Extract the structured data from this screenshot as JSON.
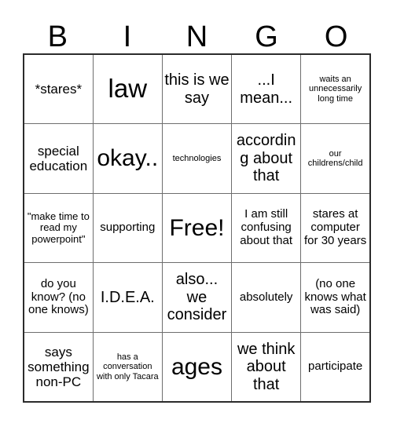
{
  "card": {
    "headers": [
      "B",
      "I",
      "N",
      "G",
      "O"
    ],
    "rows": [
      [
        {
          "text": "*stares*",
          "size": "fs-l"
        },
        {
          "text": "law",
          "size": "fs-huge"
        },
        {
          "text": "this is we say",
          "size": "fs-xl"
        },
        {
          "text": "...I mean...",
          "size": "fs-xl"
        },
        {
          "text": "waits an unnecessarily long time",
          "size": "fs-xs"
        }
      ],
      [
        {
          "text": "special education",
          "size": "fs-l"
        },
        {
          "text": "okay..",
          "size": "fs-xxl"
        },
        {
          "text": "technologies",
          "size": "fs-xs"
        },
        {
          "text": "according about that",
          "size": "fs-xl"
        },
        {
          "text": "our childrens/child",
          "size": "fs-xs"
        }
      ],
      [
        {
          "text": "\"make time to read my powerpoint\"",
          "size": "fs-s"
        },
        {
          "text": "supporting",
          "size": "fs-m"
        },
        {
          "text": "Free!",
          "size": "fs-xxl"
        },
        {
          "text": "I am still confusing about that",
          "size": "fs-m"
        },
        {
          "text": "stares at computer for 30 years",
          "size": "fs-m"
        }
      ],
      [
        {
          "text": "do you know? (no one knows)",
          "size": "fs-m"
        },
        {
          "text": "I.D.E.A.",
          "size": "fs-xl"
        },
        {
          "text": "also... we consider",
          "size": "fs-xl"
        },
        {
          "text": "absolutely",
          "size": "fs-m"
        },
        {
          "text": "(no one knows what was said)",
          "size": "fs-m"
        }
      ],
      [
        {
          "text": "says something non-PC",
          "size": "fs-l"
        },
        {
          "text": "has a conversation with only Tacara",
          "size": "fs-xs"
        },
        {
          "text": "ages",
          "size": "fs-xxl"
        },
        {
          "text": "we think about that",
          "size": "fs-xl"
        },
        {
          "text": "participate",
          "size": "fs-m"
        }
      ]
    ]
  },
  "colors": {
    "background": "#ffffff",
    "text": "#000000",
    "outer_border": "#2b2b2b",
    "inner_border": "#6e6e6e"
  }
}
